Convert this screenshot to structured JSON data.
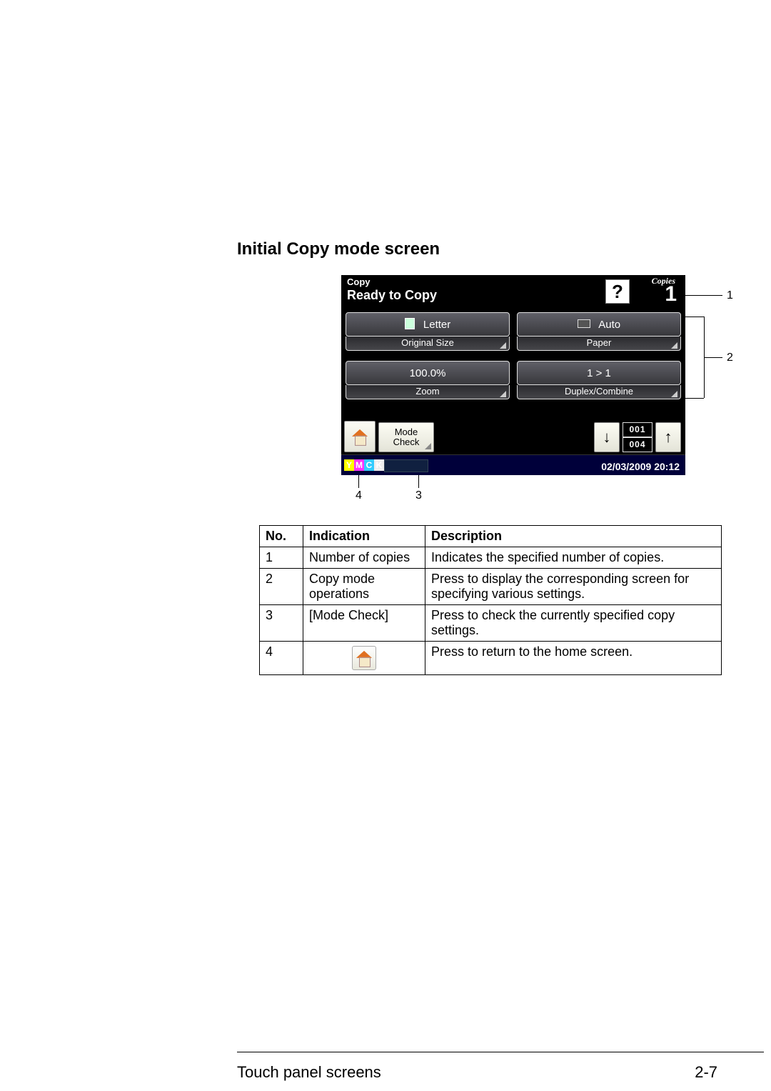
{
  "heading": "Initial Copy mode screen",
  "panel": {
    "mode": "Copy",
    "status": "Ready to Copy",
    "help_glyph": "?",
    "copies_label": "Copies",
    "copies_value": "1",
    "original_size": {
      "value": "Letter",
      "label": "Original Size"
    },
    "paper": {
      "value": "Auto",
      "label": "Paper"
    },
    "zoom": {
      "value": "100.0%",
      "label": "Zoom"
    },
    "duplex": {
      "value": "1 > 1",
      "label": "Duplex/Combine"
    },
    "mode_check_label": "Mode\nCheck",
    "page_current": "001",
    "page_total": "004",
    "scroll_down_glyph": "↓",
    "scroll_up_glyph": "↑",
    "toner": {
      "y": "Y",
      "m": "M",
      "c": "C",
      "k": "K"
    },
    "datetime": "02/03/2009  20:12"
  },
  "callouts": {
    "c1": "1",
    "c2": "2",
    "c3": "3",
    "c4": "4"
  },
  "table": {
    "headers": {
      "no": "No.",
      "ind": "Indication",
      "desc": "Description"
    },
    "rows": [
      {
        "no": "1",
        "ind": "Number of copies",
        "desc": "Indicates the specified number of copies."
      },
      {
        "no": "2",
        "ind": "Copy mode operations",
        "desc": "Press to display the corresponding screen for specifying various settings."
      },
      {
        "no": "3",
        "ind": "[Mode Check]",
        "desc": "Press to check the currently specified copy settings."
      },
      {
        "no": "4",
        "ind": "",
        "desc": "Press to return to the home screen."
      }
    ]
  },
  "footer": {
    "section": "Touch panel screens",
    "page": "2-7"
  }
}
